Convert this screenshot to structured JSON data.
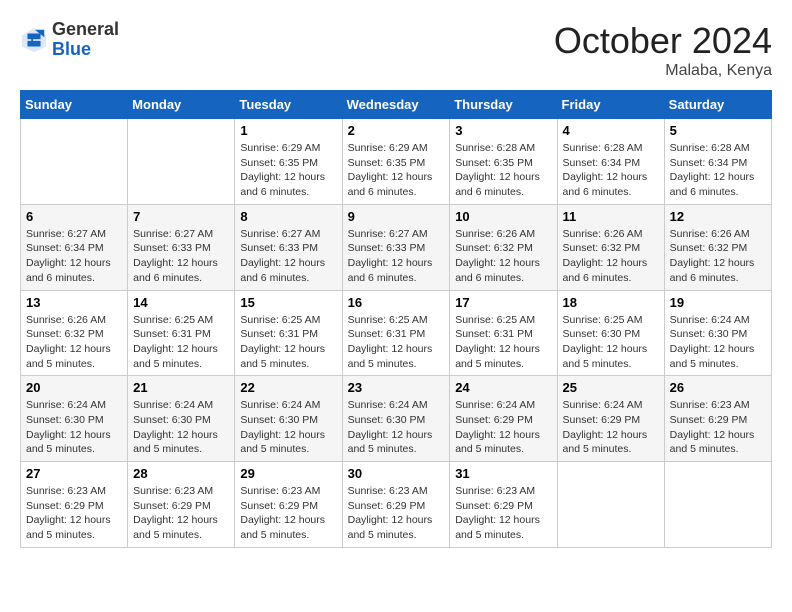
{
  "header": {
    "logo_general": "General",
    "logo_blue": "Blue",
    "month": "October 2024",
    "location": "Malaba, Kenya"
  },
  "days_of_week": [
    "Sunday",
    "Monday",
    "Tuesday",
    "Wednesday",
    "Thursday",
    "Friday",
    "Saturday"
  ],
  "weeks": [
    [
      {
        "day": "",
        "info": ""
      },
      {
        "day": "",
        "info": ""
      },
      {
        "day": "1",
        "info": "Sunrise: 6:29 AM\nSunset: 6:35 PM\nDaylight: 12 hours and 6 minutes."
      },
      {
        "day": "2",
        "info": "Sunrise: 6:29 AM\nSunset: 6:35 PM\nDaylight: 12 hours and 6 minutes."
      },
      {
        "day": "3",
        "info": "Sunrise: 6:28 AM\nSunset: 6:35 PM\nDaylight: 12 hours and 6 minutes."
      },
      {
        "day": "4",
        "info": "Sunrise: 6:28 AM\nSunset: 6:34 PM\nDaylight: 12 hours and 6 minutes."
      },
      {
        "day": "5",
        "info": "Sunrise: 6:28 AM\nSunset: 6:34 PM\nDaylight: 12 hours and 6 minutes."
      }
    ],
    [
      {
        "day": "6",
        "info": "Sunrise: 6:27 AM\nSunset: 6:34 PM\nDaylight: 12 hours and 6 minutes."
      },
      {
        "day": "7",
        "info": "Sunrise: 6:27 AM\nSunset: 6:33 PM\nDaylight: 12 hours and 6 minutes."
      },
      {
        "day": "8",
        "info": "Sunrise: 6:27 AM\nSunset: 6:33 PM\nDaylight: 12 hours and 6 minutes."
      },
      {
        "day": "9",
        "info": "Sunrise: 6:27 AM\nSunset: 6:33 PM\nDaylight: 12 hours and 6 minutes."
      },
      {
        "day": "10",
        "info": "Sunrise: 6:26 AM\nSunset: 6:32 PM\nDaylight: 12 hours and 6 minutes."
      },
      {
        "day": "11",
        "info": "Sunrise: 6:26 AM\nSunset: 6:32 PM\nDaylight: 12 hours and 6 minutes."
      },
      {
        "day": "12",
        "info": "Sunrise: 6:26 AM\nSunset: 6:32 PM\nDaylight: 12 hours and 6 minutes."
      }
    ],
    [
      {
        "day": "13",
        "info": "Sunrise: 6:26 AM\nSunset: 6:32 PM\nDaylight: 12 hours and 5 minutes."
      },
      {
        "day": "14",
        "info": "Sunrise: 6:25 AM\nSunset: 6:31 PM\nDaylight: 12 hours and 5 minutes."
      },
      {
        "day": "15",
        "info": "Sunrise: 6:25 AM\nSunset: 6:31 PM\nDaylight: 12 hours and 5 minutes."
      },
      {
        "day": "16",
        "info": "Sunrise: 6:25 AM\nSunset: 6:31 PM\nDaylight: 12 hours and 5 minutes."
      },
      {
        "day": "17",
        "info": "Sunrise: 6:25 AM\nSunset: 6:31 PM\nDaylight: 12 hours and 5 minutes."
      },
      {
        "day": "18",
        "info": "Sunrise: 6:25 AM\nSunset: 6:30 PM\nDaylight: 12 hours and 5 minutes."
      },
      {
        "day": "19",
        "info": "Sunrise: 6:24 AM\nSunset: 6:30 PM\nDaylight: 12 hours and 5 minutes."
      }
    ],
    [
      {
        "day": "20",
        "info": "Sunrise: 6:24 AM\nSunset: 6:30 PM\nDaylight: 12 hours and 5 minutes."
      },
      {
        "day": "21",
        "info": "Sunrise: 6:24 AM\nSunset: 6:30 PM\nDaylight: 12 hours and 5 minutes."
      },
      {
        "day": "22",
        "info": "Sunrise: 6:24 AM\nSunset: 6:30 PM\nDaylight: 12 hours and 5 minutes."
      },
      {
        "day": "23",
        "info": "Sunrise: 6:24 AM\nSunset: 6:30 PM\nDaylight: 12 hours and 5 minutes."
      },
      {
        "day": "24",
        "info": "Sunrise: 6:24 AM\nSunset: 6:29 PM\nDaylight: 12 hours and 5 minutes."
      },
      {
        "day": "25",
        "info": "Sunrise: 6:24 AM\nSunset: 6:29 PM\nDaylight: 12 hours and 5 minutes."
      },
      {
        "day": "26",
        "info": "Sunrise: 6:23 AM\nSunset: 6:29 PM\nDaylight: 12 hours and 5 minutes."
      }
    ],
    [
      {
        "day": "27",
        "info": "Sunrise: 6:23 AM\nSunset: 6:29 PM\nDaylight: 12 hours and 5 minutes."
      },
      {
        "day": "28",
        "info": "Sunrise: 6:23 AM\nSunset: 6:29 PM\nDaylight: 12 hours and 5 minutes."
      },
      {
        "day": "29",
        "info": "Sunrise: 6:23 AM\nSunset: 6:29 PM\nDaylight: 12 hours and 5 minutes."
      },
      {
        "day": "30",
        "info": "Sunrise: 6:23 AM\nSunset: 6:29 PM\nDaylight: 12 hours and 5 minutes."
      },
      {
        "day": "31",
        "info": "Sunrise: 6:23 AM\nSunset: 6:29 PM\nDaylight: 12 hours and 5 minutes."
      },
      {
        "day": "",
        "info": ""
      },
      {
        "day": "",
        "info": ""
      }
    ]
  ]
}
